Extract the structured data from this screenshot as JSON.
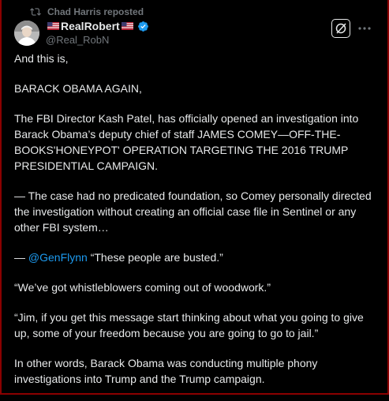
{
  "repost": {
    "icon": "repost-icon",
    "text": "Chad Harris reposted"
  },
  "author": {
    "display_name": "RealRobert",
    "handle": "@Real_RobN",
    "verified_color": "#1d9bf0",
    "avatar_icon": "profile-photo"
  },
  "actions": {
    "grok_icon": "grok-icon",
    "more_icon": "more-icon"
  },
  "tweet": {
    "p1": "And this is,",
    "p2": "BARACK OBAMA AGAIN,",
    "p3": "The FBI Director Kash Patel, has officially opened an investigation into Barack Obama’s deputy chief of staff JAMES COMEY—OFF-THE-BOOKS'HONEYPOT' OPERATION TARGETING THE 2016 TRUMP PRESIDENTIAL CAMPAIGN.",
    "p4": "— The case had no predicated foundation, so Comey personally directed the investigation without creating an official case file in Sentinel or any other FBI system…",
    "p5_prefix": "— ",
    "p5_mention": "@GenFlynn",
    "p5_rest": " “These people are busted.”",
    "p6": "“We’ve got whistleblowers coming out of woodwork.”",
    "p7": "“Jim, if you get this message start thinking about what you going to give up, some of your freedom because you are going to go to jail.”",
    "p8": "In other words, Barack Obama was conducting multiple phony investigations into Trump and the Trump campaign."
  },
  "colors": {
    "background": "#000000",
    "text": "#e7e9ea",
    "muted": "#71767b",
    "link": "#1d9bf0"
  }
}
